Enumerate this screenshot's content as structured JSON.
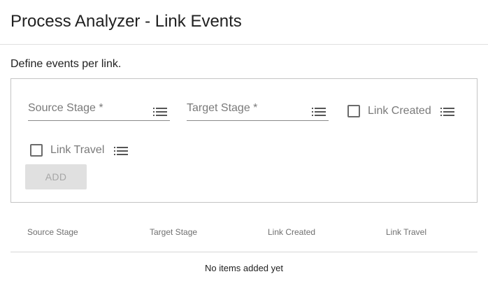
{
  "header": {
    "title": "Process Analyzer - Link Events"
  },
  "form": {
    "description": "Define events per link.",
    "source_stage_placeholder": "Source Stage *",
    "target_stage_placeholder": "Target Stage *",
    "link_created_label": "Link Created",
    "link_travel_label": "Link Travel",
    "add_label": "ADD",
    "list_icon": "list-icon"
  },
  "table": {
    "columns": [
      "Source Stage",
      "Target Stage",
      "Link Created",
      "Link Travel"
    ],
    "rows": [],
    "empty_message": "No items added yet"
  },
  "colors": {
    "border": "#c4c4c4",
    "disabled_button_bg": "#e0e0e0",
    "disabled_button_text": "#a6a6a6"
  }
}
